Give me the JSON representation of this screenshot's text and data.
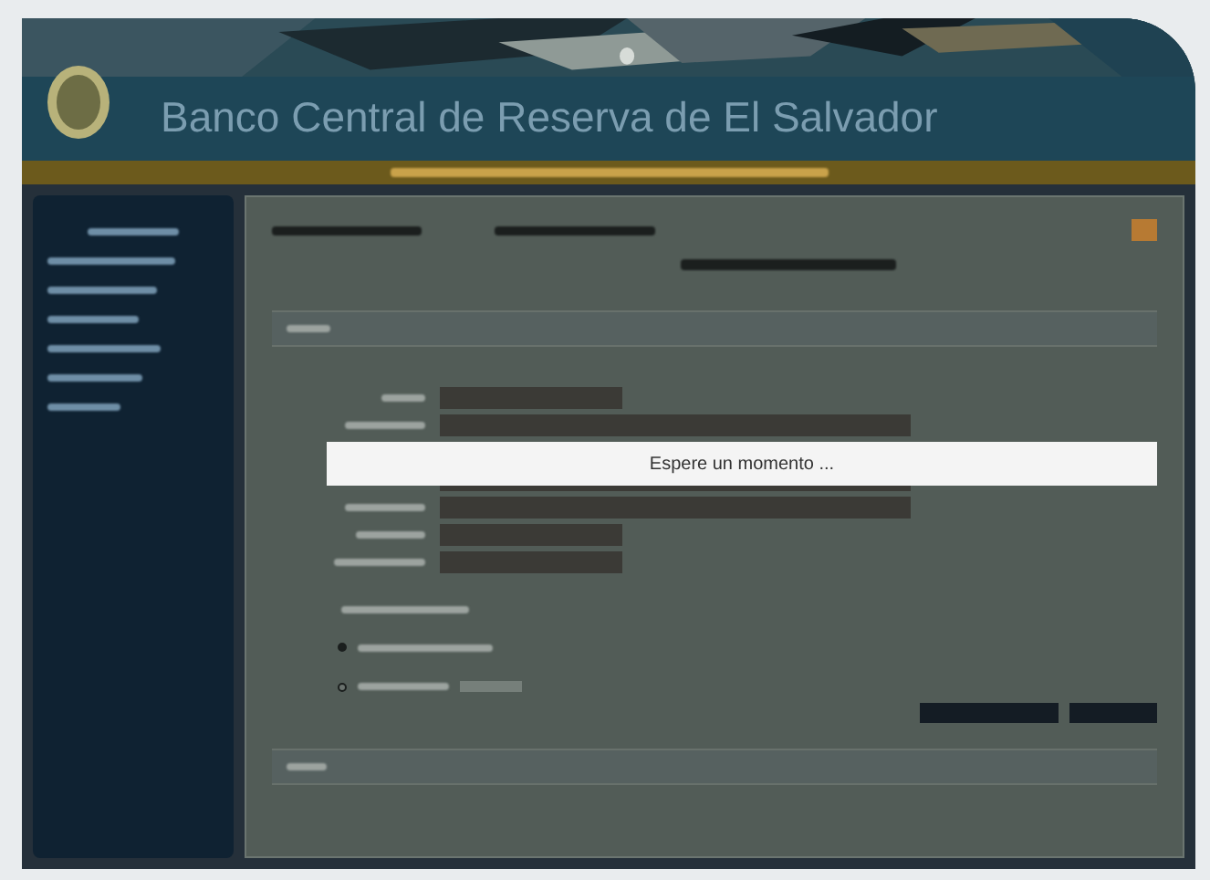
{
  "header": {
    "title": "Banco Central de Reserva de El Salvador"
  },
  "loading_dialog": {
    "message": "Espere un momento ..."
  },
  "radio_options": [
    {
      "selected": true
    },
    {
      "selected": false
    }
  ]
}
